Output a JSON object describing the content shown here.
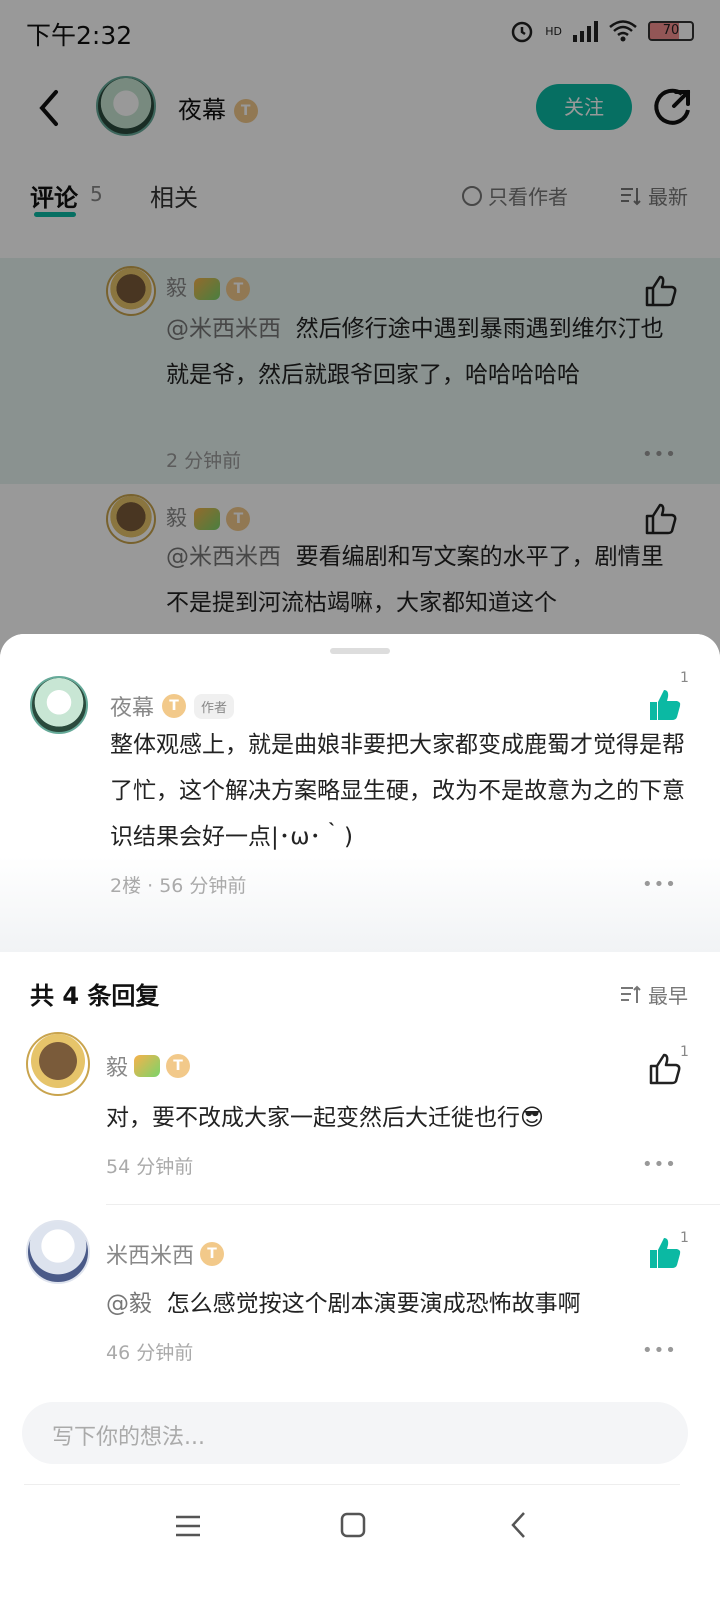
{
  "status_bar": {
    "time": "下午2:32",
    "battery": "70",
    "signal_label": "HD"
  },
  "nav": {
    "author_name": "夜幕",
    "author_level": "T",
    "follow_label": "关注"
  },
  "tabs": {
    "comments_label": "评论",
    "comments_count": "5",
    "related_label": "相关",
    "only_author_label": "只看作者",
    "sort_label": "最新"
  },
  "background_replies": [
    {
      "name": "毅",
      "level": "T",
      "mention": "@米西米西",
      "text": "然后修行途中遇到暴雨遇到维尔汀也就是爷，然后就跟爷回家了，哈哈哈哈哈",
      "time": "2 分钟前"
    },
    {
      "name": "毅",
      "level": "T",
      "mention": "@米西米西",
      "text": "要看编剧和写文案的水平了，剧情里不是提到河流枯竭嘛，大家都知道这个"
    }
  ],
  "main_comment": {
    "name": "夜幕",
    "level": "T",
    "author_tag": "作者",
    "like_count": "1",
    "text": "整体观感上，就是曲娘非要把大家都变成鹿蜀才觉得是帮了忙，这个解决方案略显生硬，改为不是故意为之的下意识结果会好一点|･ω･｀)",
    "meta": "2楼 · 56 分钟前"
  },
  "replies_header": {
    "title": "共 4 条回复",
    "sort_label": "最早"
  },
  "replies": [
    {
      "name": "毅",
      "level": "T",
      "text": "对，要不改成大家一起变然后大迁徙也行😎",
      "time": "54 分钟前",
      "like_count": "1"
    },
    {
      "name": "米西米西",
      "level": "T",
      "mention": "@毅",
      "text": "怎么感觉按这个剧本演要演成恐怖故事啊",
      "time": "46 分钟前",
      "like_count": "1"
    }
  ],
  "input": {
    "placeholder": "写下你的想法..."
  },
  "colors": {
    "accent": "#0bb9a3",
    "text": "#222222",
    "muted": "#888888"
  },
  "icons": [
    "back-icon",
    "share-icon",
    "thumbs-up-icon",
    "more-icon",
    "sort-icon",
    "menu-icon",
    "home-icon",
    "nav-back-icon"
  ]
}
